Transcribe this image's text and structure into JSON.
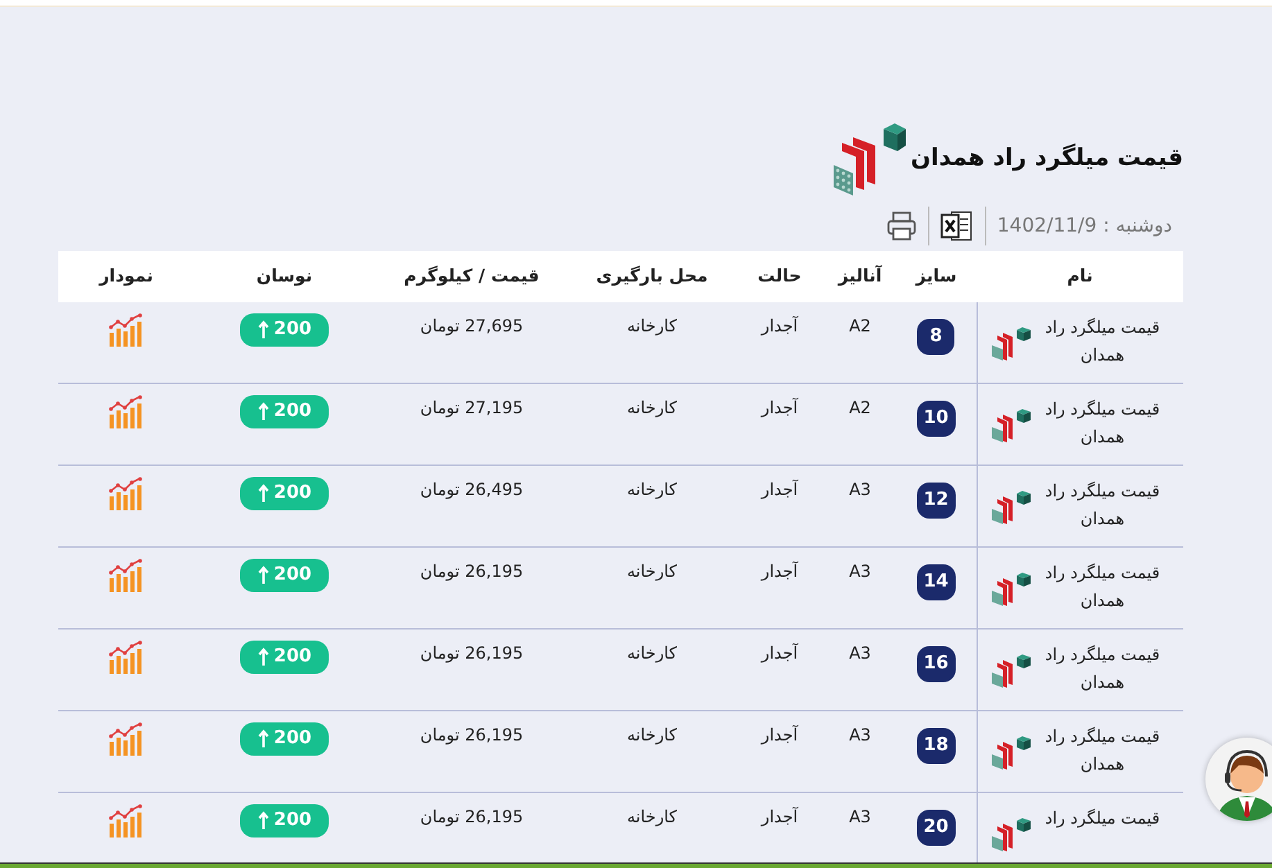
{
  "header": {
    "title": "قیمت میلگرد راد همدان",
    "date": "دوشنبه : 1402/11/9"
  },
  "table": {
    "columns": [
      "نام",
      "سایز",
      "آنالیز",
      "حالت",
      "محل بارگیری",
      "قیمت / کیلوگرم",
      "نوسان",
      "نمودار"
    ],
    "rows": [
      {
        "name": "قیمت میلگرد راد همدان",
        "size": "8",
        "analysis": "A2",
        "state": "آجدار",
        "location": "کارخانه",
        "price": "27,695 تومان",
        "change": "200"
      },
      {
        "name": "قیمت میلگرد راد همدان",
        "size": "10",
        "analysis": "A2",
        "state": "آجدار",
        "location": "کارخانه",
        "price": "27,195 تومان",
        "change": "200"
      },
      {
        "name": "قیمت میلگرد راد همدان",
        "size": "12",
        "analysis": "A3",
        "state": "آجدار",
        "location": "کارخانه",
        "price": "26,495 تومان",
        "change": "200"
      },
      {
        "name": "قیمت میلگرد راد همدان",
        "size": "14",
        "analysis": "A3",
        "state": "آجدار",
        "location": "کارخانه",
        "price": "26,195 تومان",
        "change": "200"
      },
      {
        "name": "قیمت میلگرد راد همدان",
        "size": "16",
        "analysis": "A3",
        "state": "آجدار",
        "location": "کارخانه",
        "price": "26,195 تومان",
        "change": "200"
      },
      {
        "name": "قیمت میلگرد راد همدان",
        "size": "18",
        "analysis": "A3",
        "state": "آجدار",
        "location": "کارخانه",
        "price": "26,195 تومان",
        "change": "200"
      },
      {
        "name": "قیمت میلگرد راد",
        "size": "20",
        "analysis": "A3",
        "state": "آجدار",
        "location": "کارخانه",
        "price": "26,195 تومان",
        "change": "200"
      }
    ]
  }
}
